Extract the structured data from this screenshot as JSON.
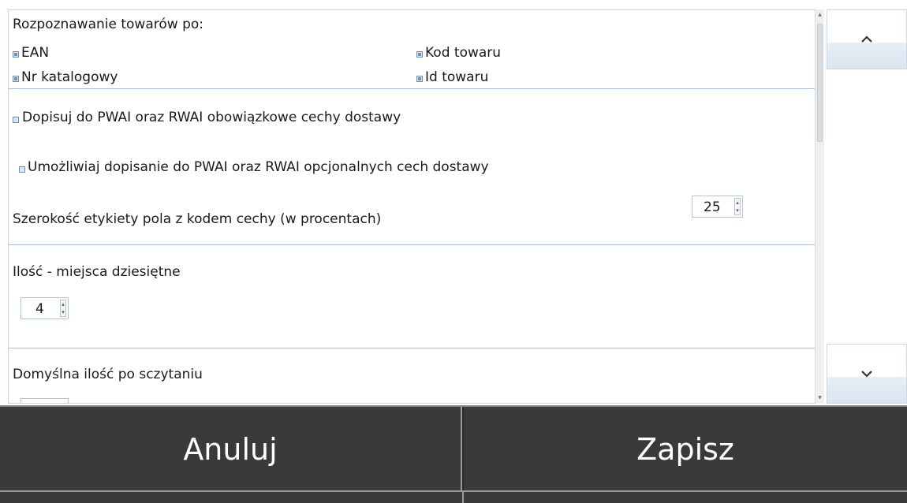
{
  "recognition": {
    "title": "Rozpoznawanie towarów po:",
    "options": [
      {
        "label": "EAN",
        "checked": true
      },
      {
        "label": "Kod towaru",
        "checked": true
      },
      {
        "label": "Nr katalogowy",
        "checked": true
      },
      {
        "label": "Id towaru",
        "checked": true
      }
    ]
  },
  "features": {
    "mandatory_label": "Dopisuj do PWAI oraz RWAI obowiązkowe cechy dostawy",
    "mandatory_checked": false,
    "optional_label": "Umożliwiaj dopisanie do PWAI oraz RWAI opcjonalnych cech dostawy",
    "optional_checked": false,
    "label_width_label": "Szerokość etykiety pola z kodem cechy (w procentach)",
    "label_width_value": "25"
  },
  "quantity": {
    "label": "Ilość - miejsca dziesiętne",
    "value": "4"
  },
  "default_qty": {
    "label": "Domyślna ilość po sczytaniu"
  },
  "actions": {
    "cancel": "Anuluj",
    "save": "Zapisz"
  },
  "colors": {
    "accent_border": "#a9c1dc",
    "action_bar": "#3a3a3a",
    "action_text": "#ffffff"
  }
}
